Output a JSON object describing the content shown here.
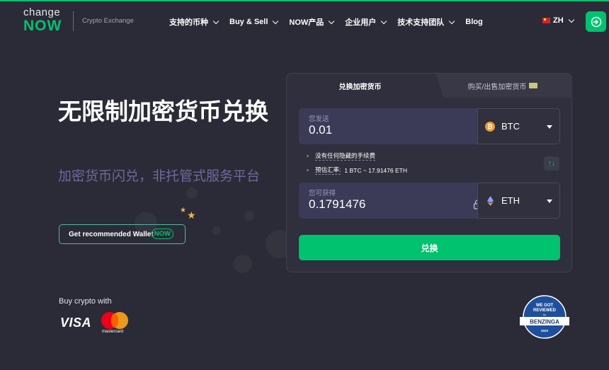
{
  "header": {
    "logo_top": "change",
    "logo_bottom": "NOW",
    "logo_sub": "Crypto Exchange",
    "nav": [
      {
        "label": "支持的币种"
      },
      {
        "label": "Buy & Sell"
      },
      {
        "label": "NOW产品"
      },
      {
        "label": "企业用户"
      },
      {
        "label": "技术支持团队"
      },
      {
        "label": "Blog"
      }
    ],
    "language": "ZH",
    "login_icon": "login-arrow-icon"
  },
  "hero": {
    "title": "无限制加密货币兑换",
    "subtitle": "加密货币闪兑，非托管式服务平台",
    "wallet_button": "Get recommended Wallet",
    "wallet_badge": "NOW"
  },
  "payments": {
    "label": "Buy crypto with",
    "visa": "VISA",
    "mastercard": "mastercard"
  },
  "widget": {
    "tab_exchange": "兑换加密货币",
    "tab_buy": "购买/出售加密货币",
    "send": {
      "label": "您发送",
      "amount": "0.01",
      "currency": "BTC"
    },
    "info_fees": "没有任何隐藏的手续费",
    "info_rate_label": "预估汇率:",
    "info_rate_value": "1 BTC ~ 17.91476 ETH",
    "swap_icon": "↑↓",
    "receive": {
      "label": "您可获得",
      "amount": "0.1791476",
      "currency": "ETH"
    },
    "exchange_button": "兑换"
  },
  "badge": {
    "line1": "WE GOT",
    "line2": "REVIEWED",
    "line3": "by",
    "brand": "BENZINGA",
    "year": "2023"
  },
  "colors": {
    "accent": "#00c26f",
    "background": "#2b2b37",
    "subtitle": "#6c6a9a"
  }
}
